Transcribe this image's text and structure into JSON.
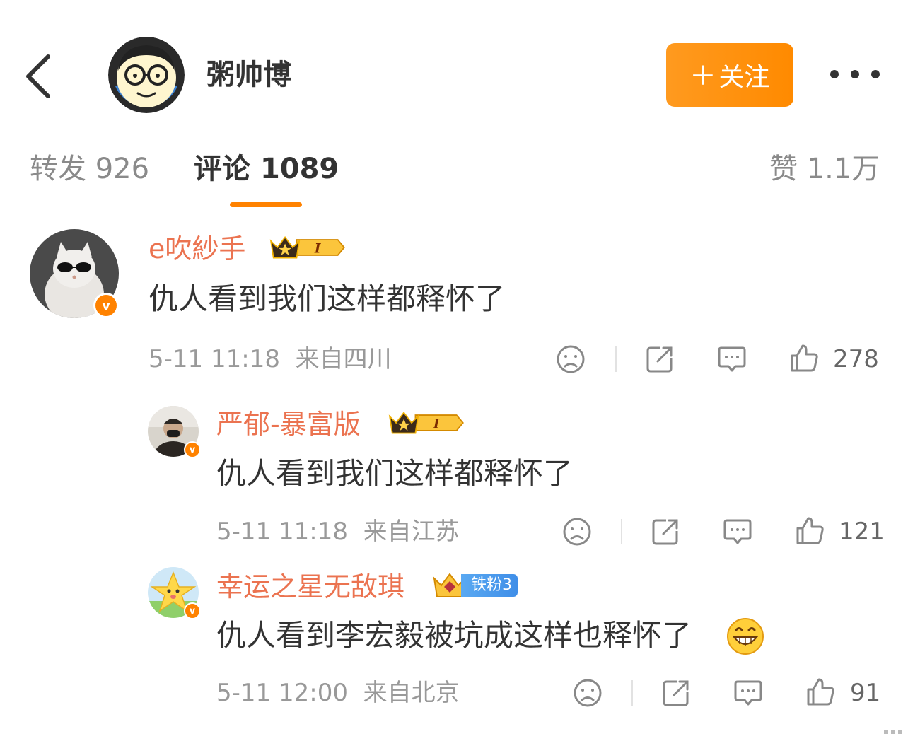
{
  "header": {
    "author_name": "粥帅博",
    "follow_label": "关注",
    "follow_plus": "+"
  },
  "tabs": {
    "repost_label": "转发",
    "repost_count": "926",
    "comment_label": "评论",
    "comment_count": "1089",
    "like_label": "赞",
    "like_count": "1.1万"
  },
  "comments": [
    {
      "username": "e吹紗手",
      "badge_level": "I",
      "text": "仇人看到我们这样都释怀了",
      "time": "5-11 11:18",
      "location": "来自四川",
      "likes": "278",
      "verified": "v"
    },
    {
      "username": "严郁-暴富版",
      "badge_level": "I",
      "text": "仇人看到我们这样都释怀了",
      "time": "5-11 11:18",
      "location": "来自江苏",
      "likes": "121",
      "verified": "v"
    },
    {
      "username": "幸运之星无敌琪",
      "fan_badge": "铁粉3",
      "text": "仇人看到李宏毅被坑成这样也释怀了",
      "time": "5-11 12:00",
      "location": "来自北京",
      "likes": "91",
      "verified": "v"
    }
  ],
  "colors": {
    "accent_orange": "#ff8200",
    "username_orange": "#eb7350",
    "fan_badge_blue": "#3f8ee8"
  }
}
